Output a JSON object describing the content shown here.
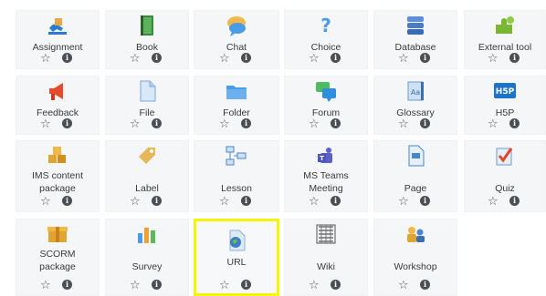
{
  "activities": [
    {
      "label": "Assignment",
      "icon": "assignment-icon"
    },
    {
      "label": "Book",
      "icon": "book-icon"
    },
    {
      "label": "Chat",
      "icon": "chat-icon"
    },
    {
      "label": "Choice",
      "icon": "choice-icon"
    },
    {
      "label": "Database",
      "icon": "database-icon"
    },
    {
      "label": "External tool",
      "icon": "puzzle-icon"
    },
    {
      "label": "Feedback",
      "icon": "megaphone-icon"
    },
    {
      "label": "File",
      "icon": "file-icon"
    },
    {
      "label": "Folder",
      "icon": "folder-icon"
    },
    {
      "label": "Forum",
      "icon": "forum-icon"
    },
    {
      "label": "Glossary",
      "icon": "glossary-icon"
    },
    {
      "label": "H5P",
      "icon": "h5p-icon",
      "badge": "H5P"
    },
    {
      "label": "IMS content package",
      "icon": "ims-package-icon"
    },
    {
      "label": "Label",
      "icon": "tag-icon"
    },
    {
      "label": "Lesson",
      "icon": "lesson-icon"
    },
    {
      "label": "MS Teams Meeting",
      "icon": "teams-icon"
    },
    {
      "label": "Page",
      "icon": "page-icon"
    },
    {
      "label": "Quiz",
      "icon": "quiz-icon"
    },
    {
      "label": "SCORM package",
      "icon": "scorm-package-icon"
    },
    {
      "label": "Survey",
      "icon": "survey-chart-icon"
    },
    {
      "label": "URL",
      "icon": "url-globe-icon",
      "highlighted": true
    },
    {
      "label": "Wiki",
      "icon": "wiki-icon"
    },
    {
      "label": "Workshop",
      "icon": "workshop-icon"
    }
  ],
  "action_glyphs": {
    "star": "☆",
    "info": "i"
  },
  "colors": {
    "highlight": "#f5f50a",
    "tile_bg": "#f5f6f7"
  }
}
